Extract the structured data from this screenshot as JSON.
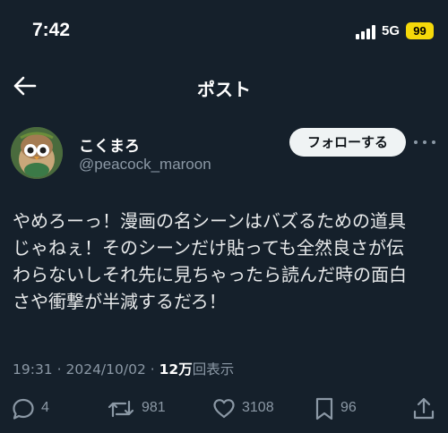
{
  "status_bar": {
    "time": "7:42",
    "network": "5G",
    "battery": "99"
  },
  "header": {
    "title": "ポスト"
  },
  "author": {
    "display_name": "こくまろ",
    "handle": "@peacock_maroon",
    "follow_label": "フォローする"
  },
  "post": {
    "text": "やめろーっ！漫画の名シーンはバズるための道具\nじゃねぇ！そのシーンだけ貼っても全然良さが伝\nわらないしそれ先に見ちゃったら読んだ時の面白\nさや衝撃が半減するだろ！",
    "time": "19:31",
    "date": "2024/10/02",
    "separator": "·",
    "views_count": "12万",
    "views_label": "回表示"
  },
  "actions": {
    "replies": "4",
    "reposts": "981",
    "likes": "3108",
    "bookmarks": "96"
  },
  "colors": {
    "background": "#15202b",
    "secondary_text": "#8b98a5",
    "battery": "#f5d90a"
  }
}
